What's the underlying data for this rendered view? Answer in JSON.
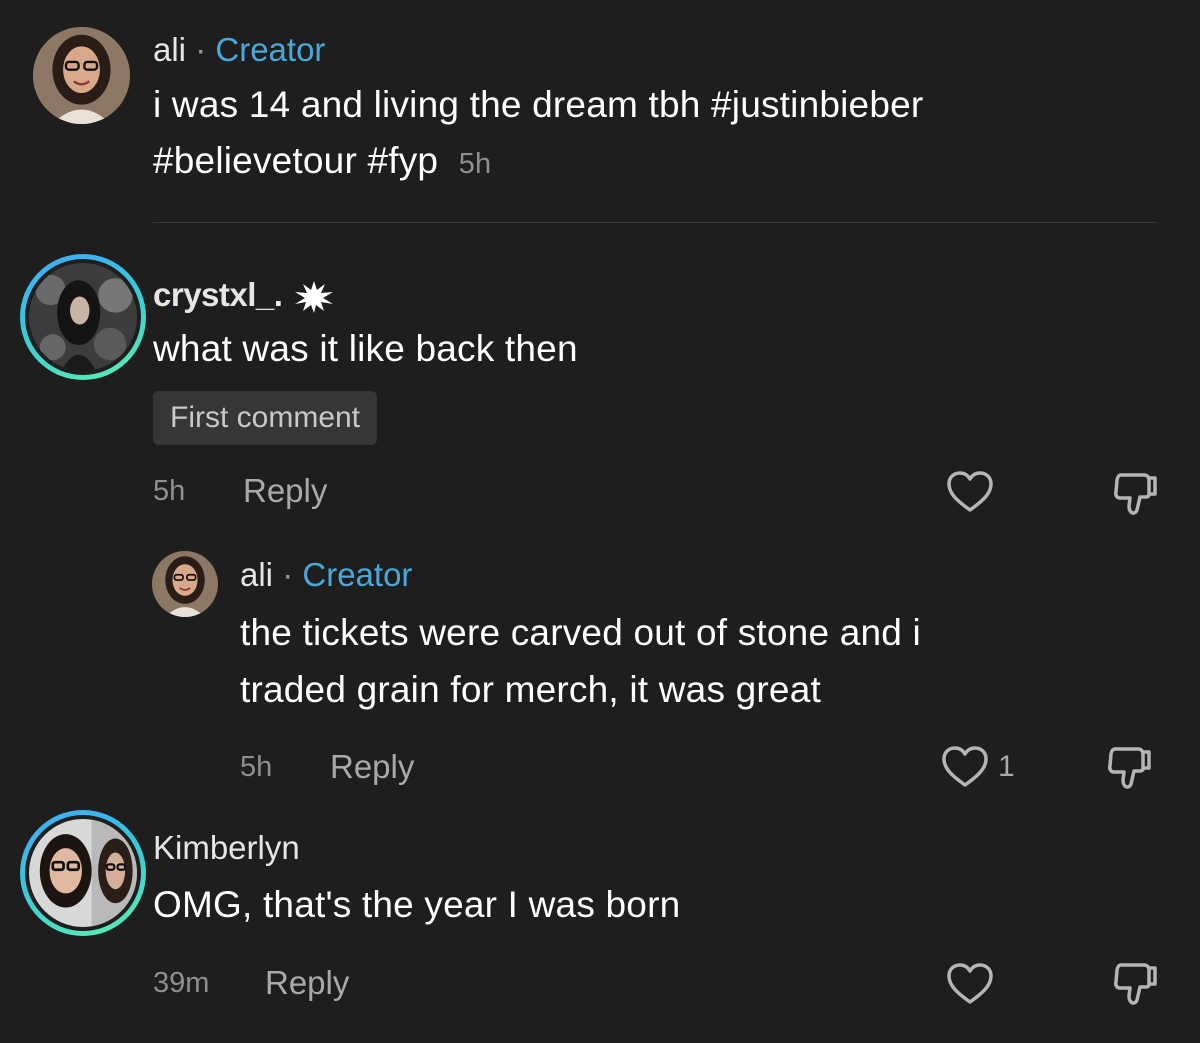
{
  "post": {
    "author": "ali",
    "separator": "·",
    "role": "Creator",
    "caption_line1": "i was 14 and living the dream tbh #justinbieber",
    "caption_line2": "#believetour #fyp",
    "time": "5h"
  },
  "comments": [
    {
      "username": "crystxl_.",
      "text": "what was it like back then",
      "badge": "First comment",
      "time": "5h",
      "reply_label": "Reply",
      "likes": ""
    },
    {
      "username": "ali",
      "separator": "·",
      "role": "Creator",
      "text_line1": "the tickets were carved out of stone and i",
      "text_line2": "traded grain for merch, it was great",
      "time": "5h",
      "reply_label": "Reply",
      "likes": "1"
    },
    {
      "username": "Kimberlyn",
      "text": "OMG, that's the year I was born",
      "time": "39m",
      "reply_label": "Reply",
      "likes": ""
    }
  ],
  "colors": {
    "background": "#1e1e1e",
    "creator_label": "#4aa8d8",
    "ring_gradient": [
      "#3ea8ff",
      "#5df0b0"
    ]
  },
  "icons": [
    "heart-icon",
    "thumbs-down-icon",
    "sparkle-badge-icon"
  ]
}
